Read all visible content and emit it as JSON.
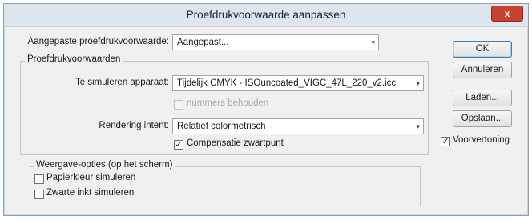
{
  "window": {
    "title": "Proefdrukvoorwaarde aanpassen",
    "close_glyph": "x"
  },
  "custom_condition": {
    "label": "Aangepaste proefdrukvoorwaarde:",
    "value": "Aangepast..."
  },
  "proof_conditions": {
    "legend": "Proefdrukvoorwaarden",
    "device_label": "Te simuleren apparaat:",
    "device_value": "Tijdelijk CMYK - ISOuncoated_VIGC_47L_220_v2.icc",
    "preserve_numbers_label": "nummers behouden",
    "preserve_numbers_checked": false,
    "preserve_numbers_disabled": true,
    "rendering_label": "Rendering intent:",
    "rendering_value": "Relatief colormetrisch",
    "blackpoint_label": "Compensatie zwartpunt",
    "blackpoint_checked": true
  },
  "display_options": {
    "legend": "Weergave-opties (op het scherm)",
    "paper_color_label": "Papierkleur simuleren",
    "paper_color_checked": false,
    "black_ink_label": "Zwarte inkt simuleren",
    "black_ink_checked": false
  },
  "buttons": {
    "ok": "OK",
    "cancel": "Annuleren",
    "load": "Laden...",
    "save": "Opslaan..."
  },
  "preview": {
    "label": "Voorvertoning",
    "checked": true
  },
  "glyphs": {
    "check": "✓",
    "dropdown": "▾"
  },
  "colors": {
    "close_button": "#c64230",
    "titlebar": "#dde6ef",
    "dialog_background": "#f0f0f0"
  }
}
